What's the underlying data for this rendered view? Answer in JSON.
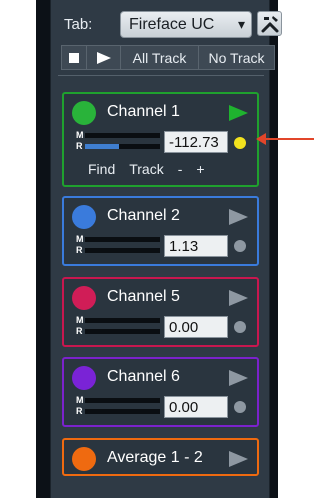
{
  "toolbar": {
    "tab_label": "Tab:",
    "device": "Fireface UC",
    "all_track": "All Track",
    "no_track": "No Track"
  },
  "channels": [
    {
      "name": "Channel 1",
      "gain": "-112.73",
      "color": "#1fa12e",
      "dot": "#29b33a",
      "active": true,
      "selected": true,
      "meter_r_level": 0.45
    },
    {
      "name": "Channel 2",
      "gain": "1.13",
      "color": "#3a7bdc",
      "dot": "#3a7bdc",
      "active": false,
      "selected": false,
      "meter_r_level": 0
    },
    {
      "name": "Channel 5",
      "gain": "0.00",
      "color": "#c8174f",
      "dot": "#d01d57",
      "active": false,
      "selected": false,
      "meter_r_level": 0
    },
    {
      "name": "Channel 6",
      "gain": "0.00",
      "color": "#7b22cc",
      "dot": "#7a23d6",
      "active": false,
      "selected": false,
      "meter_r_level": 0
    }
  ],
  "average": {
    "name": "Average 1 - 2",
    "color": "#ef6a10"
  },
  "channel1_footer": {
    "find": "Find",
    "track": "Track",
    "minus": "-",
    "plus": "+"
  },
  "meter_labels": {
    "m": "M",
    "r": "R"
  },
  "colors": {
    "panel": "#2f3a45",
    "arrow": "#e2462a"
  }
}
